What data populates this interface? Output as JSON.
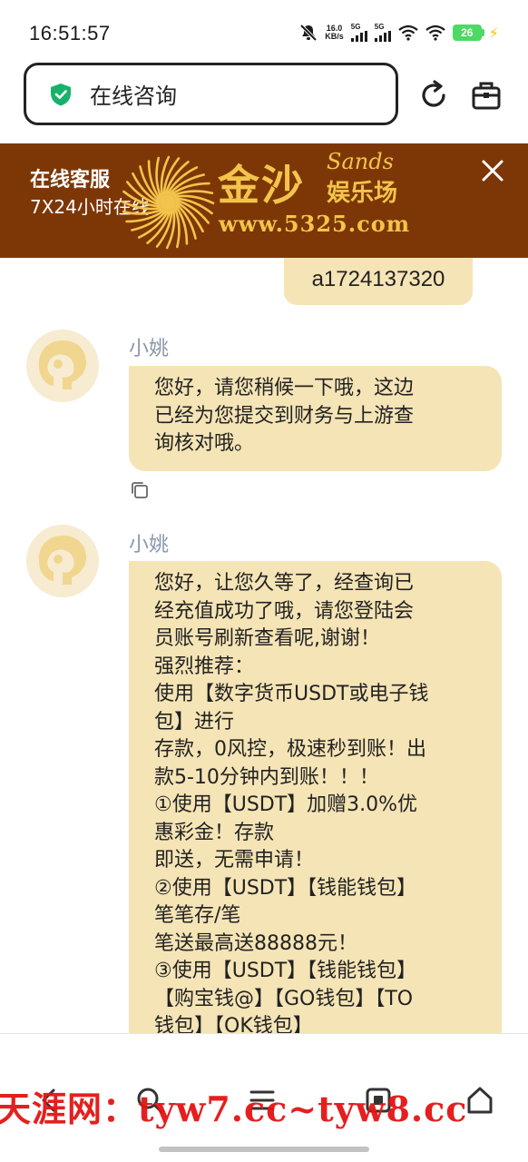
{
  "status_bar": {
    "time": "16:51:57",
    "net_speed_value": "16.0",
    "net_speed_unit": "KB/s",
    "sim1_label": "5G",
    "sim2_label": "5G",
    "battery": "26",
    "icons": [
      "mute-icon",
      "signal-icon",
      "wifi-icon",
      "battery-icon",
      "charging-icon"
    ]
  },
  "url_bar": {
    "title": "在线咨询",
    "icons": [
      "shield-check-icon",
      "reload-icon",
      "tabs-icon"
    ]
  },
  "banner": {
    "title": "在线客服",
    "subtitle": "7X24小时在线",
    "brand_cn": "金沙",
    "brand_en": "Sands",
    "brand_sub": "娱乐场",
    "brand_url": "www.5325.com",
    "background": "#7d3706",
    "accent": "#f3c44b"
  },
  "chat": {
    "user_message": "a1724137320",
    "messages": [
      {
        "sender": "小姚",
        "text": "您好，请您稍候一下哦，这边\n已经为您提交到财务与上游查\n询核对哦。"
      },
      {
        "sender": "小姚",
        "text": "您好，让您久等了，经查询已\n经充值成功了哦，请您登陆会\n员账号刷新查看呢,谢谢！\n强烈推荐：\n使用【数字货币USDT或电子钱\n包】进行\n存款，0风控，极速秒到账！出\n款5-10分钟内到账！！！\n①使用【USDT】加赠3.0%优\n惠彩金！存款\n即送，无需申请！\n②使用【USDT】【钱能钱包】\n笔笔存/笔\n笔送最高送88888元！\n③使用【USDT】【钱能钱包】\n【购宝钱@】【GO钱包】【TO\n钱包】【OK钱包】"
      }
    ],
    "bubble_color": "#f5e4b6",
    "sender_color": "#8a96a8"
  },
  "bottom_nav": {
    "watermark": "天涯网：tyw7.cc~tyw8.cc",
    "icons": [
      "back-icon",
      "search-icon",
      "menu-icon",
      "tabs-icon",
      "home-icon"
    ]
  }
}
